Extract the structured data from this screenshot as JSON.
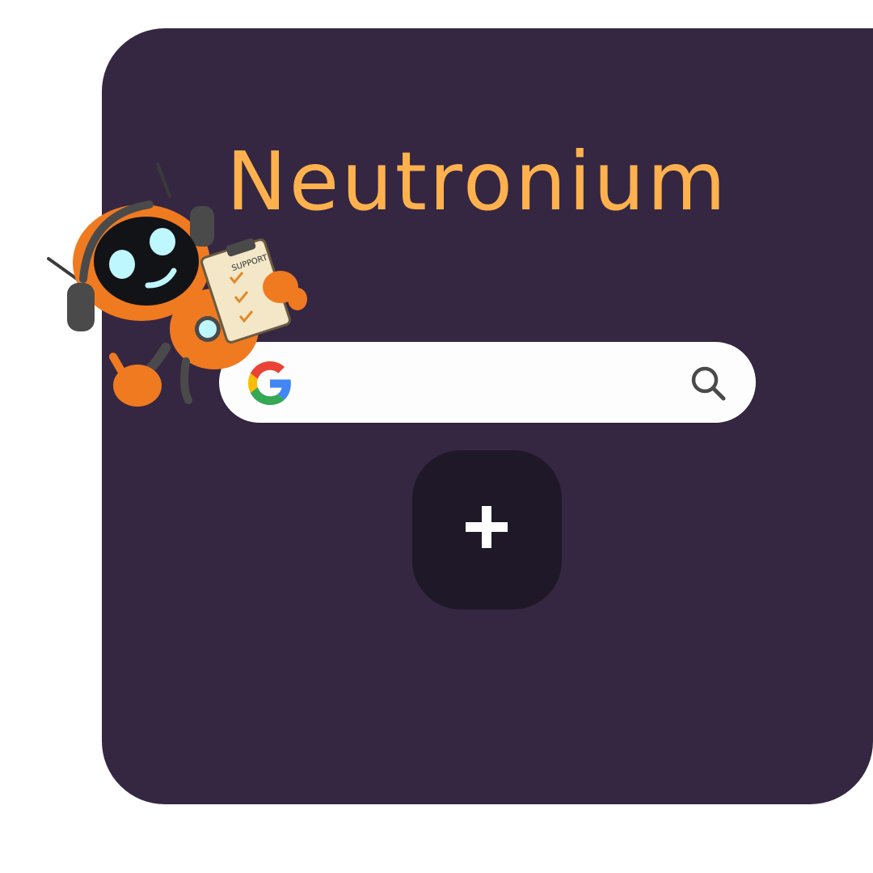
{
  "app": {
    "title": "Neutronium"
  },
  "search": {
    "placeholder": "",
    "value": "",
    "provider_icon": "google-g-icon",
    "action_icon": "search-icon"
  },
  "add_button": {
    "icon": "plus-icon"
  },
  "mascot": {
    "icon": "support-robot-mascot",
    "clipboard_text": "SUPPORT"
  },
  "colors": {
    "background": "#ffffff",
    "panel": "#352742",
    "title": "#ffb14e",
    "search_bar": "#fdfdfd",
    "add_button": "#1f1828",
    "mascot_orange": "#f07a20"
  }
}
